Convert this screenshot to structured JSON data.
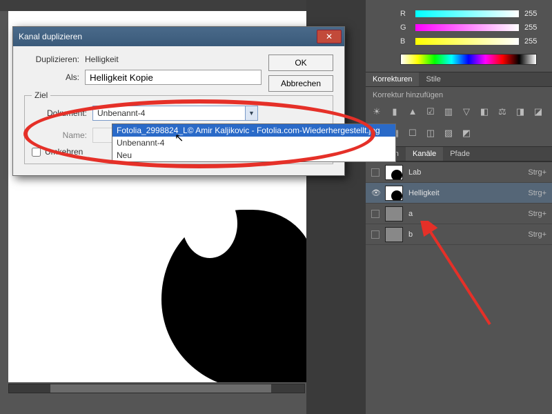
{
  "dialog": {
    "title": "Kanal duplizieren",
    "close_glyph": "✕",
    "duplicate_label": "Duplizieren:",
    "duplicate_value": "Helligkeit",
    "as_label": "Als:",
    "as_value": "Helligkeit Kopie",
    "ok_label": "OK",
    "cancel_label": "Abbrechen",
    "fieldset_legend": "Ziel",
    "document_label": "Dokument:",
    "document_selected": "Unbenannt-4",
    "options": [
      "Fotolia_2998824_L© Amir Kaljikovic - Fotolia.com-Wiederhergestellt.jpg",
      "Unbenannt-4",
      "Neu"
    ],
    "selected_option_index": 0,
    "name_label": "Name:",
    "invert_label": "Umkehren"
  },
  "color_panel": {
    "channels": [
      {
        "label": "R",
        "value": "255"
      },
      {
        "label": "G",
        "value": "255"
      },
      {
        "label": "B",
        "value": "255"
      }
    ]
  },
  "adjustments": {
    "tab1": "Korrekturen",
    "tab2": "Stile",
    "add_label": "Korrektur hinzufügen",
    "icons": [
      "☀",
      "▮",
      "▲",
      "☑",
      "▥",
      "▽",
      "◧",
      "⚖",
      "◨",
      "◪",
      "⟳",
      "▦",
      "☐",
      "◫",
      "▨",
      "◩",
      "◈"
    ]
  },
  "channels_panel": {
    "tabs": {
      "t1": "Ebenen",
      "t2": "Kanäle",
      "t3": "Pfade"
    },
    "rows": [
      {
        "name": "Lab",
        "key": "Strg+",
        "visible": false
      },
      {
        "name": "Helligkeit",
        "key": "Strg+",
        "visible": true
      },
      {
        "name": "a",
        "key": "Strg+",
        "visible": false
      },
      {
        "name": "b",
        "key": "Strg+",
        "visible": false
      }
    ]
  },
  "cursor_glyph": "↖"
}
